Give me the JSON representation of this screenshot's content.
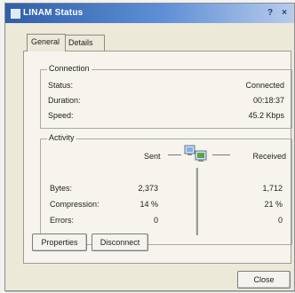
{
  "window": {
    "title": "LINAM Status",
    "help_glyph": "?",
    "close_glyph": "×"
  },
  "tabs": [
    {
      "label": "General",
      "active": true
    },
    {
      "label": "Details",
      "active": false
    }
  ],
  "connection": {
    "title": "Connection",
    "rows": [
      {
        "label": "Status:",
        "value": "Connected"
      },
      {
        "label": "Duration:",
        "value": "00:18:37"
      },
      {
        "label": "Speed:",
        "value": "45.2 Kbps"
      }
    ]
  },
  "activity": {
    "title": "Activity",
    "sent_label": "Sent",
    "received_label": "Received",
    "rows": [
      {
        "label": "Bytes:",
        "sent": "2,373",
        "received": "1,712"
      },
      {
        "label": "Compression:",
        "sent": "14 %",
        "received": "21 %"
      },
      {
        "label": "Errors:",
        "sent": "0",
        "received": "0"
      }
    ]
  },
  "buttons": {
    "properties": "Properties",
    "disconnect": "Disconnect",
    "close": "Close"
  },
  "colors": {
    "titlebar_start": "#2f5fa8",
    "titlebar_end": "#b8ccea",
    "window_bg": "#ece9d8"
  }
}
